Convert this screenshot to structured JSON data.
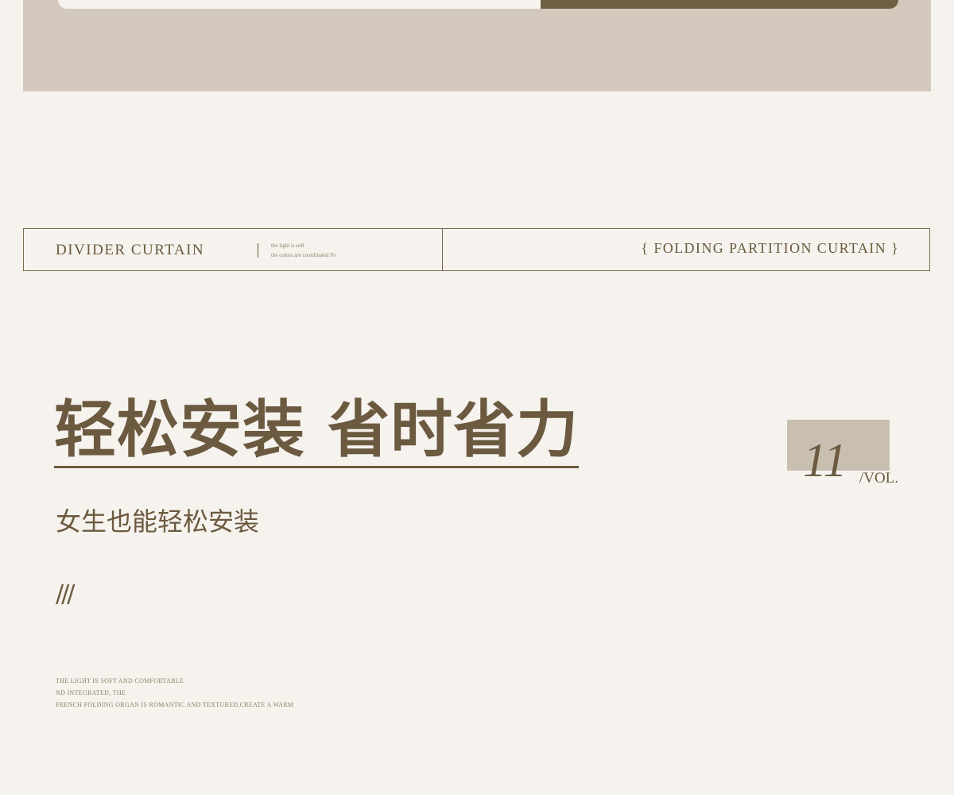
{
  "header_strip": {
    "left_title": "DIVIDER CURTAIN",
    "small_lines": [
      "the light is soft",
      "the colors are coordinated Fo"
    ],
    "right_title": "{ FOLDING PARTITION CURTAIN }"
  },
  "main": {
    "title": "轻松安装 省时省力",
    "subtitle": "女生也能轻松安装",
    "slashes": "///",
    "fine_print": [
      "THE LIGHT IS SOFT AND COMFORTABLE",
      "ND INTEGRATED, THE",
      "FRENCH FOLDING ORGAN IS ROMANTIC AND TEXTURED,CREATE A WARM"
    ]
  },
  "volume": {
    "number": "11",
    "label": "/VOL."
  },
  "colors": {
    "background": "#f6f3ee",
    "band": "#d4c9bd",
    "accent_dark": "#6e5f42",
    "text_brown": "#6c5a40",
    "vol_box": "#c8bfb0"
  }
}
